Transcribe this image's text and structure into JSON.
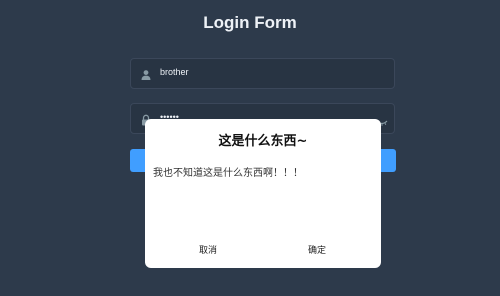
{
  "form": {
    "title": "Login Form",
    "username_value": "brother",
    "password_value": "••••••"
  },
  "dialog": {
    "title": "这是什么东西~",
    "message": "我也不知道这是什么东西啊！！！",
    "cancel_label": "取消",
    "confirm_label": "确定"
  },
  "icons": {
    "username": "user-icon",
    "password": "lock-icon",
    "toggle": "eye-icon"
  },
  "colors": {
    "background": "#2d3a4b",
    "primary": "#409eff",
    "dialog_bg": "#ffffff"
  }
}
